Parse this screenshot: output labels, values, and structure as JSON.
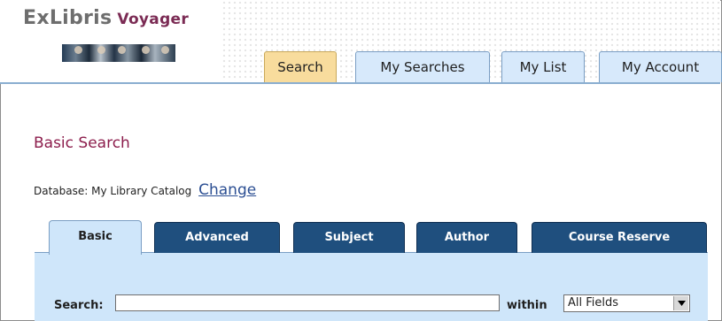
{
  "header": {
    "logo_ex": "ExLibris",
    "logo_voyager": "Voyager",
    "tabs": [
      {
        "label": "Search",
        "active": true
      },
      {
        "label": "My Searches",
        "active": false
      },
      {
        "label": "My List",
        "active": false
      },
      {
        "label": "My Account",
        "active": false
      }
    ]
  },
  "page": {
    "title": "Basic Search",
    "database_label": "Database:",
    "database_name": "My Library Catalog",
    "change_link": "Change"
  },
  "search_tabs": [
    {
      "label": "Basic",
      "active": true
    },
    {
      "label": "Advanced",
      "active": false
    },
    {
      "label": "Subject",
      "active": false
    },
    {
      "label": "Author",
      "active": false
    },
    {
      "label": "Course Reserve",
      "active": false
    }
  ],
  "form": {
    "search_label": "Search:",
    "search_value": "",
    "within_label": "within",
    "within_selected": "All Fields"
  },
  "colors": {
    "accent_title": "#8c1d4c",
    "active_tab": "#f8dc9d",
    "tab_bg": "#d7e9fb",
    "search_tab_dark": "#1f4f7e",
    "panel_bg": "#cfe6fa"
  }
}
